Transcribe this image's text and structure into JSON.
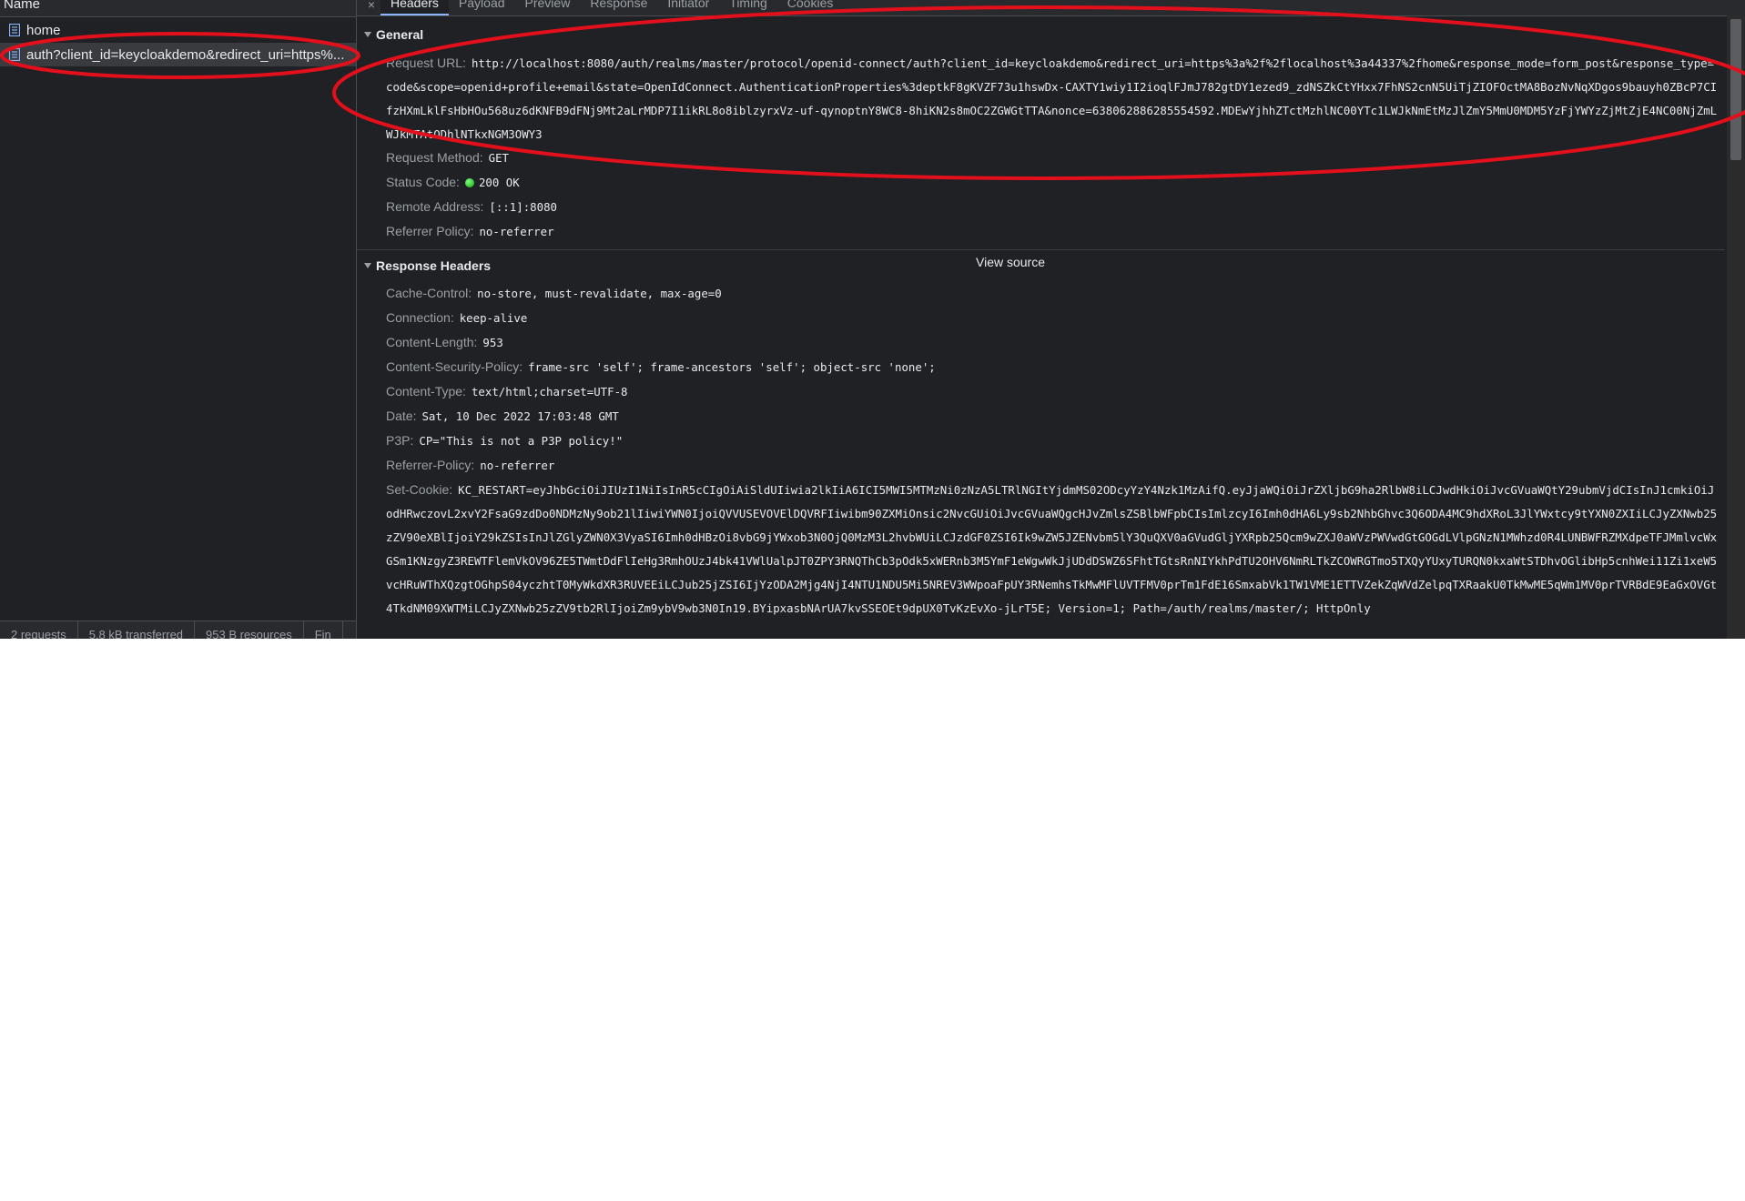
{
  "request_list": {
    "column_header": "Name",
    "items": [
      {
        "label": "home"
      },
      {
        "label": "auth?client_id=keycloakdemo&redirect_uri=https%..."
      }
    ],
    "status_bar": [
      "2 requests",
      "5.8 kB transferred",
      "953 B resources",
      "Fin"
    ]
  },
  "tabs": {
    "close": "×",
    "items": [
      "Headers",
      "Payload",
      "Preview",
      "Response",
      "Initiator",
      "Timing",
      "Cookies"
    ],
    "active": "Headers"
  },
  "general": {
    "title": "General",
    "request_url_key": "Request URL:",
    "request_url": "http://localhost:8080/auth/realms/master/protocol/openid-connect/auth?client_id=keycloakdemo&redirect_uri=https%3a%2f%2flocalhost%3a44337%2fhome&response_mode=form_post&response_type=code&scope=openid+profile+email&state=OpenIdConnect.AuthenticationProperties%3deptkF8gKVZF73u1hswDx-CAXTY1wiy1I2ioqlFJmJ782gtDY1ezed9_zdNSZkCtYHxx7FhNS2cnN5UiTjZIOFOctMA8BozNvNqXDgos9bauyh0ZBcP7CIfzHXmLklFsHbHOu568uz6dKNFB9dFNj9Mt2aLrMDP7I1ikRL8o8iblzyrxVz-uf-qynoptnY8WC8-8hiKN2s8mOC2ZGWGtTTA&nonce=638062886285554592.MDEwYjhhZTctMzhlNC00YTc1LWJkNmEtMzJlZmY5MmU0MDM5YzFjYWYzZjMtZjE4NC00NjZmLWJkMTAtODhlNTkxNGM3OWY3",
    "request_method_key": "Request Method:",
    "request_method": "GET",
    "status_code_key": "Status Code:",
    "status_code": "200 OK",
    "status_color": "#22c322",
    "remote_address_key": "Remote Address:",
    "remote_address": "[::1]:8080",
    "referrer_policy_key": "Referrer Policy:",
    "referrer_policy": "no-referrer"
  },
  "response_headers": {
    "title": "Response Headers",
    "view_source": "View source",
    "items": [
      {
        "key": "Cache-Control:",
        "value": "no-store, must-revalidate, max-age=0"
      },
      {
        "key": "Connection:",
        "value": "keep-alive"
      },
      {
        "key": "Content-Length:",
        "value": "953"
      },
      {
        "key": "Content-Security-Policy:",
        "value": "frame-src 'self'; frame-ancestors 'self'; object-src 'none';"
      },
      {
        "key": "Content-Type:",
        "value": "text/html;charset=UTF-8"
      },
      {
        "key": "Date:",
        "value": "Sat, 10 Dec 2022 17:03:48 GMT"
      },
      {
        "key": "P3P:",
        "value": "CP=\"This is not a P3P policy!\""
      },
      {
        "key": "Referrer-Policy:",
        "value": "no-referrer"
      },
      {
        "key": "Set-Cookie:",
        "value": "KC_RESTART=eyJhbGciOiJIUzI1NiIsInR5cCIgOiAiSldUIiwia2lkIiA6ICI5MWI5MTMzNi0zNzA5LTRlNGItYjdmMS02ODcyYzY4Nzk1MzAifQ.eyJjaWQiOiJrZXljbG9ha2RlbW8iLCJwdHkiOiJvcGVuaWQtY29ubmVjdCIsInJ1cmkiOiJodHRwczovL2xvY2FsaG9zdDo0NDMzNy9ob21lIiwiYWN0IjoiQVVUSEVOVElDQVRFIiwibm90ZXMiOnsic2NvcGUiOiJvcGVuaWQgcHJvZmlsZSBlbWFpbCIsImlzcyI6Imh0dHA6Ly9sb2NhbGhvc3Q6ODA4MC9hdXRoL3JlYWxtcy9tYXN0ZXIiLCJyZXNwb25zZV90eXBlIjoiY29kZSIsInJlZGlyZWN0X3VyaSI6Imh0dHBzOi8vbG9jYWxob3N0OjQ0MzM3L2hvbWUiLCJzdGF0ZSI6Ik9wZW5JZENvbm5lY3QuQXV0aGVudGljYXRpb25Qcm9wZXJ0aWVzPWVwdGtGOGdLVlpGNzN1MWhzd0R4LUNBWFRZMXdpeTFJMmlvcWxGSm1KNzgyZ3REWTFlemVkOV96ZE5TWmtDdFlIeHg3RmhOUzJ4bk41VWlUalpJT0ZPY3RNQThCb3pOdk5xWERnb3M5YmF1eWgwWkJjUDdDSWZ6SFhtTGtsRnNIYkhPdTU2OHV6NmRLTkZCOWRGTmo5TXQyYUxyTURQN0kxaWtSTDhvOGlibHp5cnhWei11Zi1xeW5vcHRuWThXQzgtOGhpS04yczhtT0MyWkdXR3RUVEEiLCJub25jZSI6IjYzODA2Mjg4NjI4NTU1NDU5Mi5NREV3WWpoaFpUY3RNemhsTkMwMFlUVTFMV0prTm1FdE16SmxabVk1TW1VME1ETTVZekZqWVdZelpqTXRaakU0TkMwME5qWm1MV0prTVRBdE9EaGxOVGt4TkdNM09XWTMiLCJyZXNwb25zZV9tb2RlIjoiZm9ybV9wb3N0In19.BYipxasbNArUA7kvSSEOEt9dpUX0TvKzEvXo-jLrT5E; Version=1; Path=/auth/realms/master/; HttpOnly"
      }
    ]
  },
  "colors": {
    "background": "#202124",
    "annotation": "#e3101c",
    "text": "#e8eaed",
    "muted": "#9aa0a6"
  },
  "icons": {
    "document": "document-icon",
    "collapse": "triangle-down-icon"
  }
}
